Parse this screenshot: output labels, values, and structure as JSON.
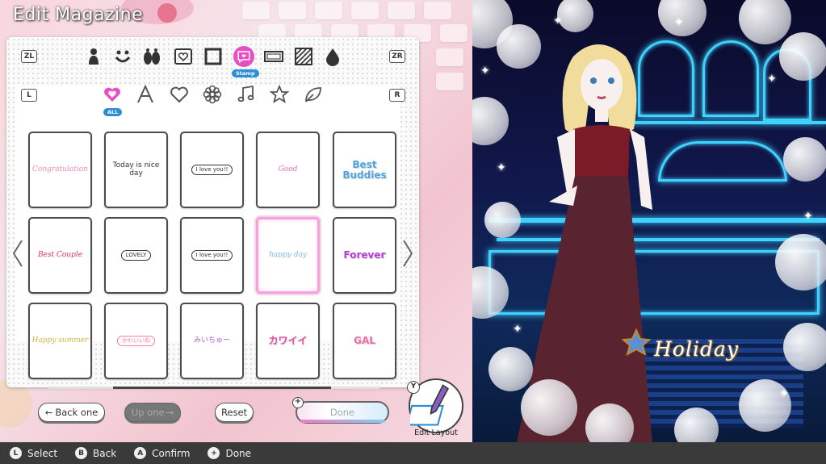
{
  "header": {
    "title": "Edit Magazine"
  },
  "tabs": {
    "left_shoulder": "ZL",
    "right_shoulder": "ZR",
    "left_sub": "L",
    "right_sub": "R",
    "categories": [
      {
        "icon": "person-silhouette-icon"
      },
      {
        "icon": "smile-icon"
      },
      {
        "icon": "dog-silhouette-icon"
      },
      {
        "icon": "heart-frame-icon"
      },
      {
        "icon": "square-frame-icon"
      },
      {
        "icon": "stamp-icon",
        "selected": true,
        "label": "Stamp"
      },
      {
        "icon": "banner-icon"
      },
      {
        "icon": "pattern-icon"
      },
      {
        "icon": "drop-icon"
      }
    ],
    "sub_categories": [
      {
        "icon": "heart-all-icon",
        "selected": true,
        "label": "ALL"
      },
      {
        "icon": "letter-a-icon"
      },
      {
        "icon": "heart-outline-icon"
      },
      {
        "icon": "flower-icon"
      },
      {
        "icon": "music-note-icon"
      },
      {
        "icon": "star-icon"
      },
      {
        "icon": "leaf-icon"
      }
    ]
  },
  "grid": {
    "tiles": [
      {
        "text": "Congratulation",
        "color": "#f08bb6",
        "style": "script"
      },
      {
        "text": "Today is nice day",
        "color": "#333333",
        "style": "plain"
      },
      {
        "text": "I love you!!",
        "color": "#333333",
        "style": "bubble"
      },
      {
        "text": "Good",
        "color": "#f06aa8",
        "style": "script"
      },
      {
        "text": "Best Buddies",
        "color": "#4fa3e0",
        "style": "bold"
      },
      {
        "text": "Best Couple",
        "color": "#e2335b",
        "style": "script"
      },
      {
        "text": "LOVELY",
        "color": "#333333",
        "style": "pill"
      },
      {
        "text": "I love you!!",
        "color": "#333333",
        "style": "bubble"
      },
      {
        "text": "happy day",
        "color": "#7fb7e8",
        "style": "script",
        "selected": true
      },
      {
        "text": "Forever",
        "color": "#b13ad8",
        "style": "bold"
      },
      {
        "text": "Happy summer",
        "color": "#d6b042",
        "style": "script"
      },
      {
        "text": "かわいいね",
        "color": "#ff7aa8",
        "style": "pill"
      },
      {
        "text": "みいちゅー",
        "color": "#b65fd6",
        "style": "plain"
      },
      {
        "text": "カワイイ",
        "color": "#e04aa6",
        "style": "bold"
      },
      {
        "text": "GAL",
        "color": "#f06aa8",
        "style": "bold"
      }
    ]
  },
  "buttons": {
    "back_one": "Back one",
    "up_one": "Up one",
    "reset": "Reset",
    "done": "Done",
    "done_plus": "+",
    "edit_layout": "Edit Layout",
    "edit_layout_key": "Y"
  },
  "scene": {
    "overlay_text": "Holiday"
  },
  "footer": {
    "hints": [
      {
        "key": "L",
        "label": "Select"
      },
      {
        "key": "B",
        "label": "Back"
      },
      {
        "key": "A",
        "label": "Confirm"
      },
      {
        "key": "+",
        "label": "Done"
      }
    ]
  },
  "colors": {
    "accent_pink": "#e94fc4",
    "accent_blue": "#2c8fd6",
    "neon": "#3fd2ff"
  }
}
